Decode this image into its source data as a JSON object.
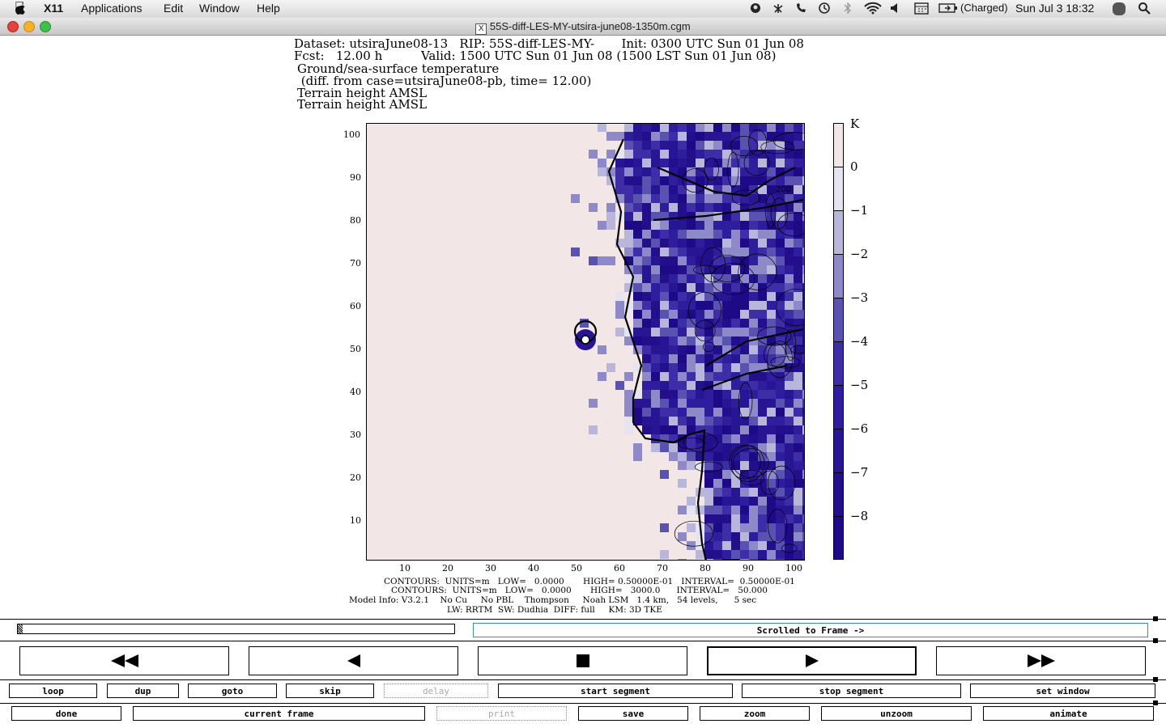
{
  "menubar": {
    "app": "X11",
    "items": [
      "Applications",
      "Edit",
      "Window",
      "Help"
    ],
    "battery": "(Charged)",
    "clock": "Sun Jul 3  18:32"
  },
  "window": {
    "title": "55S-diff-LES-MY-utsira-june08-1350m.cgm"
  },
  "header": {
    "line1": "Dataset: utsiraJune08-13   RIP: 55S-diff-LES-MY-       Init: 0300 UTC Sun 01 Jun 08",
    "line2": "Fcst:   12.00 h          Valid: 1500 UTC Sun 01 Jun 08 (1500 LST Sun 01 Jun 08)",
    "line3": "Ground/sea-surface temperature",
    "line4": " (diff. from case=utsiraJune08-pb, time= 12.00)",
    "line5": "Terrain height AMSL",
    "line6": "Terrain height AMSL"
  },
  "plot": {
    "yticks": [
      "100",
      "90",
      "80",
      "70",
      "60",
      "50",
      "40",
      "30",
      "20",
      "10"
    ],
    "xticks": [
      "10",
      "20",
      "30",
      "40",
      "50",
      "60",
      "70",
      "80",
      "90",
      "100"
    ],
    "contour_label": "200"
  },
  "colorbar": {
    "unit": "K",
    "labels": [
      "0",
      "−1",
      "−2",
      "−3",
      "−4",
      "−5",
      "−6",
      "−7",
      "−8"
    ],
    "colors": [
      "#f2e6e6",
      "#e6e4f0",
      "#b9b6dc",
      "#8e89c8",
      "#5a52b0",
      "#3d2ea8",
      "#2e1d9c",
      "#281594",
      "#230f8c",
      "#1e0a86"
    ]
  },
  "footer": {
    "l1": "CONTOURS:  UNITS=m   LOW=   0.0000       HIGH= 0.50000E-01   INTERVAL=  0.50000E-01",
    "l2": "CONTOURS:  UNITS=m   LOW=   0.0000       HIGH=   3000.0      INTERVAL=   50.000",
    "l3": "Model Info: V3.2.1    No Cu     No PBL    Thompson     Noah LSM   1.4 km,   54 levels,      5 sec",
    "l4": "LW: RRTM  SW: Dudhia  DIFF: full     KM: 3D TKE"
  },
  "status": {
    "scrolled": "Scrolled to Frame ->"
  },
  "controls": {
    "row1": [
      "loop",
      "dup",
      "goto",
      "skip",
      "delay",
      "start segment",
      "stop segment",
      "set window"
    ],
    "row2": [
      "done",
      "current frame",
      "print",
      "save",
      "zoom",
      "unzoom",
      "animate"
    ]
  }
}
